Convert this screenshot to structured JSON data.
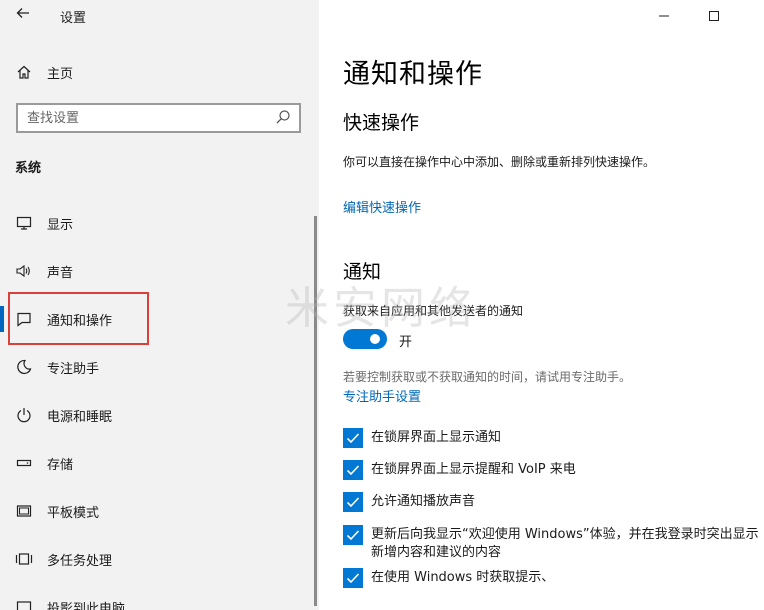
{
  "window": {
    "title": "设置"
  },
  "sidebar": {
    "home_label": "主页",
    "search_placeholder": "查找设置",
    "section_label": "系统",
    "items": [
      {
        "label": "显示",
        "icon": "monitor-icon"
      },
      {
        "label": "声音",
        "icon": "speaker-icon"
      },
      {
        "label": "通知和操作",
        "icon": "notification-icon",
        "active": true
      },
      {
        "label": "专注助手",
        "icon": "moon-icon"
      },
      {
        "label": "电源和睡眠",
        "icon": "power-icon"
      },
      {
        "label": "存储",
        "icon": "storage-icon"
      },
      {
        "label": "平板模式",
        "icon": "tablet-icon"
      },
      {
        "label": "多任务处理",
        "icon": "multitask-icon"
      },
      {
        "label": "投影到此电脑",
        "icon": "project-icon"
      }
    ]
  },
  "main": {
    "title": "通知和操作",
    "quick_actions": {
      "heading": "快速操作",
      "description": "你可以直接在操作中心中添加、删除或重新排列快速操作。",
      "edit_link": "编辑快速操作"
    },
    "notifications": {
      "heading": "通知",
      "toggle_label": "获取来自应用和其他发送者的通知",
      "toggle_state": "开",
      "toggle_on": true,
      "hint": "若要控制获取或不获取通知的时间，请试用专注助手。",
      "focus_link": "专注助手设置",
      "checkboxes": [
        {
          "label": "在锁屏界面上显示通知",
          "checked": true
        },
        {
          "label": "在锁屏界面上显示提醒和 VoIP 来电",
          "checked": true
        },
        {
          "label": "允许通知播放声音",
          "checked": true
        },
        {
          "label": "更新后向我显示“欢迎使用 Windows”体验，并在我登录时突出显示新增内容和建议的内容",
          "checked": true
        },
        {
          "label": "在使用 Windows 时获取提示、",
          "checked": true
        }
      ]
    }
  },
  "watermark": "米安网络",
  "colors": {
    "accent": "#0078d4",
    "link": "#0067b8",
    "highlight": "#d9403a"
  }
}
